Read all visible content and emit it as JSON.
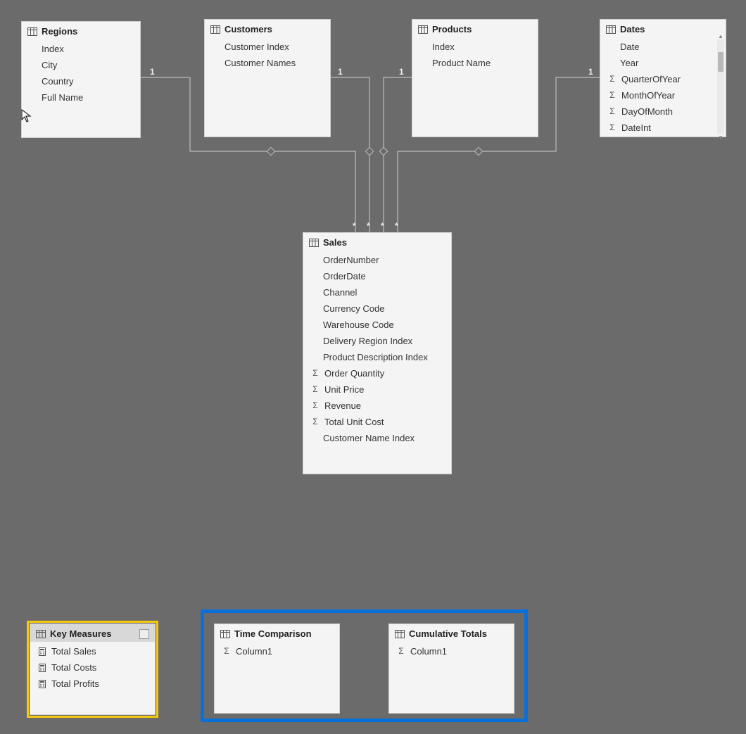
{
  "tables": {
    "regions": {
      "title": "Regions",
      "fields": [
        {
          "label": "Index",
          "icon": null
        },
        {
          "label": "City",
          "icon": null
        },
        {
          "label": "Country",
          "icon": null
        },
        {
          "label": "Full Name",
          "icon": null
        }
      ]
    },
    "customers": {
      "title": "Customers",
      "fields": [
        {
          "label": "Customer Index",
          "icon": null
        },
        {
          "label": "Customer Names",
          "icon": null
        }
      ]
    },
    "products": {
      "title": "Products",
      "fields": [
        {
          "label": "Index",
          "icon": null
        },
        {
          "label": "Product Name",
          "icon": null
        }
      ]
    },
    "dates": {
      "title": "Dates",
      "fields": [
        {
          "label": "Date",
          "icon": null
        },
        {
          "label": "Year",
          "icon": null
        },
        {
          "label": "QuarterOfYear",
          "icon": "sigma"
        },
        {
          "label": "MonthOfYear",
          "icon": "sigma"
        },
        {
          "label": "DayOfMonth",
          "icon": "sigma"
        },
        {
          "label": "DateInt",
          "icon": "sigma"
        }
      ]
    },
    "sales": {
      "title": "Sales",
      "fields": [
        {
          "label": "OrderNumber",
          "icon": null
        },
        {
          "label": "OrderDate",
          "icon": null
        },
        {
          "label": "Channel",
          "icon": null
        },
        {
          "label": "Currency Code",
          "icon": null
        },
        {
          "label": "Warehouse Code",
          "icon": null
        },
        {
          "label": "Delivery Region Index",
          "icon": null
        },
        {
          "label": "Product Description Index",
          "icon": null
        },
        {
          "label": "Order Quantity",
          "icon": "sigma"
        },
        {
          "label": "Unit Price",
          "icon": "sigma"
        },
        {
          "label": "Revenue",
          "icon": "sigma"
        },
        {
          "label": "Total Unit Cost",
          "icon": "sigma"
        },
        {
          "label": "Customer Name Index",
          "icon": null
        }
      ]
    },
    "key_measures": {
      "title": "Key Measures",
      "fields": [
        {
          "label": "Total Sales",
          "icon": "calc"
        },
        {
          "label": "Total Costs",
          "icon": "calc"
        },
        {
          "label": "Total Profits",
          "icon": "calc"
        }
      ]
    },
    "time_comparison": {
      "title": "Time Comparison",
      "fields": [
        {
          "label": "Column1",
          "icon": "sigma"
        }
      ]
    },
    "cumulative_totals": {
      "title": "Cumulative Totals",
      "fields": [
        {
          "label": "Column1",
          "icon": "sigma"
        }
      ]
    }
  },
  "cardinality": {
    "one": "1",
    "many": "*"
  }
}
